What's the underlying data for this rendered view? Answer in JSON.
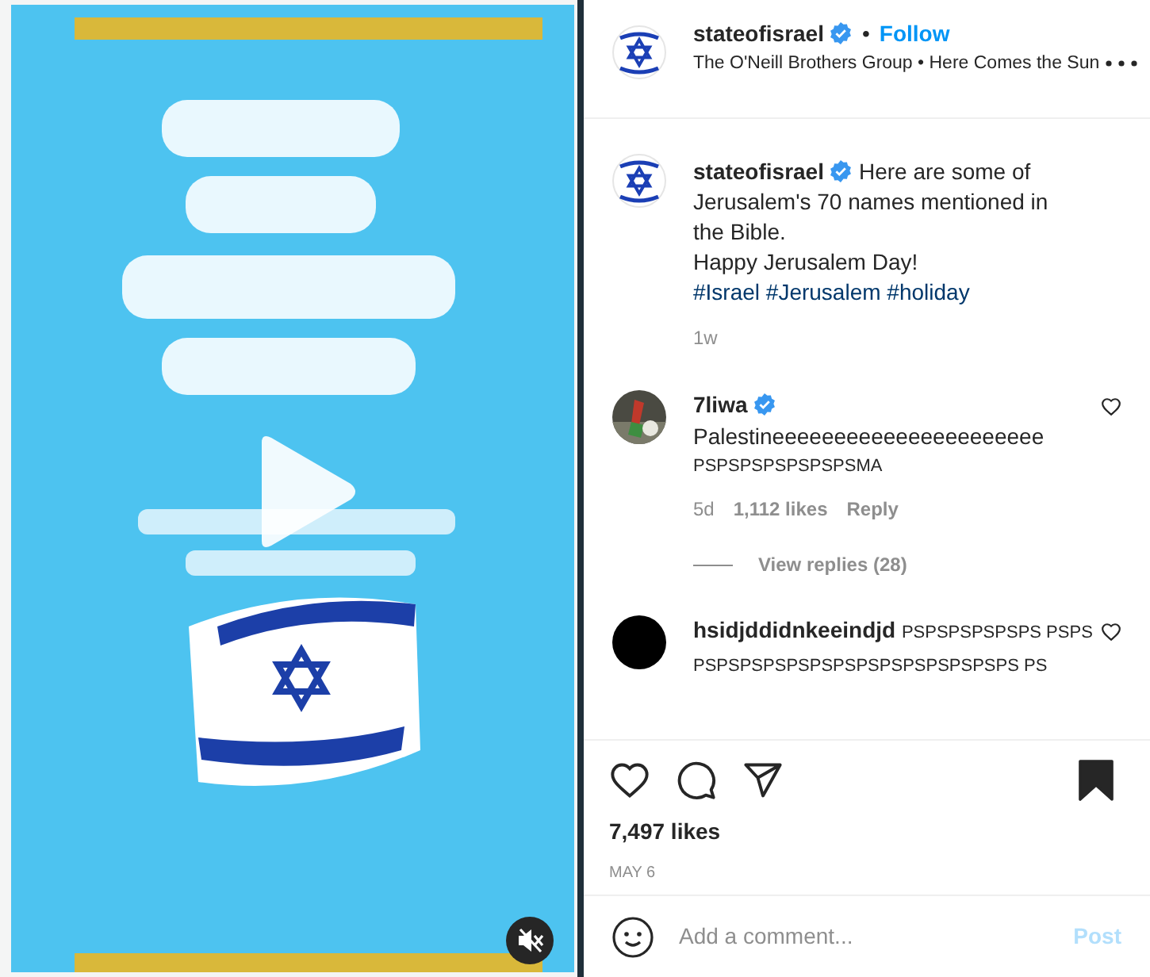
{
  "video": {
    "kind": "picture",
    "muted": true
  },
  "header": {
    "username": "stateofisrael",
    "verified": true,
    "separator": "•",
    "follow": "Follow",
    "audio": "The O'Neill Brothers Group • Here Comes the Sun"
  },
  "caption": {
    "username": "stateofisrael",
    "verified": true,
    "lines": [
      "Here are some of Jerusalem's 70 names mentioned in the Bible.",
      "Happy Jerusalem Day!"
    ],
    "hashtags": "#Israel #Jerusalem #holiday",
    "time": "1w"
  },
  "comments": [
    {
      "username": "7liwa",
      "verified": true,
      "avatar": {
        "kind": "picture"
      },
      "text": "Palestineeeeeeeeeeeeeeeeeeeeee",
      "subtext": "PSPSPSPSPSPSPSMA",
      "time": "5d",
      "likes": "1,112 likes",
      "reply": "Reply",
      "view_replies": "View replies (28)",
      "liked": false
    },
    {
      "username": "hsidjddidnkeeindjd",
      "verified": false,
      "avatar": {
        "kind": "dark"
      },
      "inline_text": "PSPSPSPSPSPS PSPSPSPSPSPSPSPSPSPSPSPSPSPSPSPS PS",
      "liked": false
    }
  ],
  "actions": {
    "liked": false,
    "saved": true
  },
  "likes": "7,497 likes",
  "date": "MAY 6",
  "comment_field": {
    "placeholder": "Add a comment...",
    "post": "Post",
    "post_disabled": true
  }
}
